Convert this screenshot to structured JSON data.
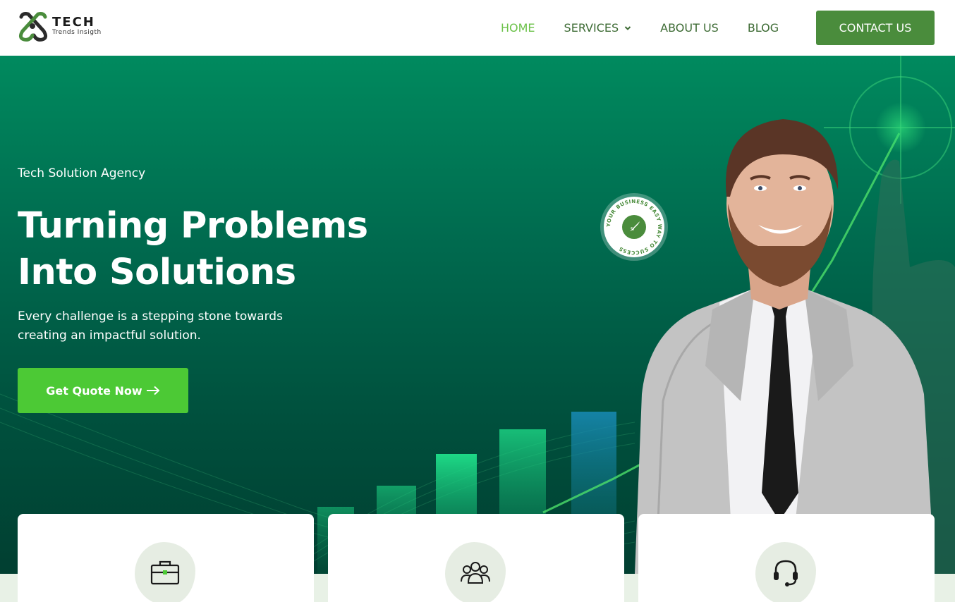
{
  "header": {
    "logo": {
      "title": "TECH",
      "subtitle": "Trends Insigth"
    },
    "nav": [
      {
        "label": "HOME",
        "active": true
      },
      {
        "label": "SERVICES",
        "has_dropdown": true
      },
      {
        "label": "ABOUT US"
      },
      {
        "label": "BLOG"
      }
    ],
    "contact_label": "CONTACT US"
  },
  "hero": {
    "tagline": "Tech Solution Agency",
    "title_line1": "Turning Problems",
    "title_line2": "Into Solutions",
    "description": "Every challenge is a stepping stone towards creating an impactful solution.",
    "cta_label": "Get Quote Now",
    "badge_text": "YOUR BUSINESS EASY WAY TO SUCCESS"
  },
  "cards": [
    {
      "icon": "briefcase-icon"
    },
    {
      "icon": "team-icon"
    },
    {
      "icon": "headset-icon"
    }
  ],
  "colors": {
    "brand_green": "#4a8c3c",
    "accent_green": "#4cc935",
    "nav_active": "#6cc24a",
    "hero_top": "#008a5e",
    "hero_bottom": "#013f31"
  }
}
